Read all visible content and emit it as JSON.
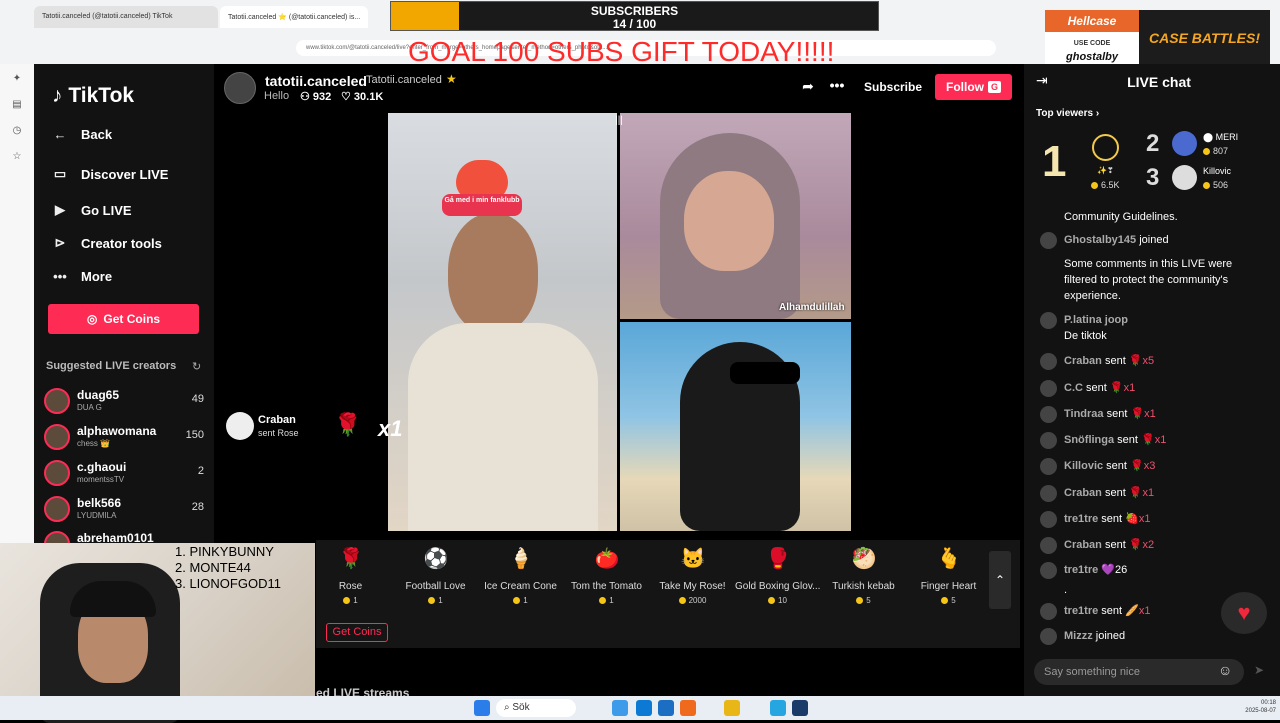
{
  "browser": {
    "tabs": [
      "Tatotii.canceled (@tatotii.canceled) TikTok",
      "Tatotii.canceled ⭐ (@tatotii.canceled) is..."
    ],
    "url": "www.tiktok.com/@tatotii.canceled/live?enter_from_merge=others_homepage&enter_method=others_photo&oth..."
  },
  "overlay": {
    "subscribers_label": "SUBSCRIBERS",
    "subscribers_count": "14 / 100",
    "subscribers_progress": 0.14,
    "goal_text": "GOAL 100 SUBS GIFT TODAY!!!!!",
    "hellcase": {
      "brand": "Hellcase",
      "use_code": "USE CODE",
      "code": "ghostalby",
      "cta": "CASE BATTLES!"
    },
    "leaderboard": [
      "1.  PINKYBUNNY",
      "2.  MONTE44",
      "3.  LIONOFGOD11"
    ]
  },
  "sidebar": {
    "logo": "TikTok",
    "nav": [
      {
        "label": "Back",
        "icon": "arrow-left-icon"
      },
      {
        "label": "Discover LIVE",
        "icon": "tv-icon"
      },
      {
        "label": "Go LIVE",
        "icon": "camera-icon"
      },
      {
        "label": "Creator tools",
        "icon": "play-square-icon"
      },
      {
        "label": "More",
        "icon": "dots-icon"
      }
    ],
    "get_coins": "Get Coins",
    "suggested_title": "Suggested LIVE creators",
    "creators": [
      {
        "name": "duag65",
        "sub": "DUA G",
        "count": "49"
      },
      {
        "name": "alphawomana",
        "sub": "chess 👑",
        "count": "150"
      },
      {
        "name": "c.ghaoui",
        "sub": "momentssTV",
        "count": "2"
      },
      {
        "name": "belk566",
        "sub": "LYUDMILA",
        "count": "28"
      },
      {
        "name": "abreham0101",
        "sub": "",
        "count": ""
      }
    ]
  },
  "stream": {
    "host_name": "tatotii.canceled",
    "host_handle": "Tatotii.canceled",
    "hello": "Hello",
    "viewers": "932",
    "likes": "30.1K",
    "subscribe": "Subscribe",
    "follow": "Follow",
    "follow_badge": "G",
    "badge_text": "Gå med i min fanklubb",
    "caption": "Alhamdulillah",
    "gift_notice": {
      "name": "Craban",
      "text": "sent Rose",
      "mult": "x1"
    }
  },
  "gifts": [
    {
      "name": "Rose",
      "price": "1",
      "icon": "🌹"
    },
    {
      "name": "Football Love",
      "price": "1",
      "icon": "⚽"
    },
    {
      "name": "Ice Cream Cone",
      "price": "1",
      "icon": "🍦"
    },
    {
      "name": "Tom the Tomato",
      "price": "1",
      "icon": "🍅"
    },
    {
      "name": "Take My Rose!",
      "price": "2000",
      "icon": "🐱"
    },
    {
      "name": "Gold Boxing Glov...",
      "price": "10",
      "icon": "🥊"
    },
    {
      "name": "Turkish kebab",
      "price": "5",
      "icon": "🥙"
    },
    {
      "name": "Finger Heart",
      "price": "5",
      "icon": "🫰"
    }
  ],
  "gift_bar": {
    "get_coins": "Get Coins",
    "below": "ed LIVE streams"
  },
  "chat": {
    "title": "LIVE chat",
    "top_viewers": "Top viewers",
    "rank1": {
      "rank": "1",
      "name": "✨❣",
      "score": "6.5K"
    },
    "rank2": {
      "rank": "2",
      "name": "MERI",
      "score": "807"
    },
    "rank3": {
      "rank": "3",
      "name": "Killovic",
      "score": "506"
    },
    "messages": [
      {
        "user": "",
        "text": "Community Guidelines.",
        "gift": ""
      },
      {
        "user": "Ghostalby145",
        "text": " joined",
        "gift": ""
      },
      {
        "user": "",
        "text": "Some comments in this LIVE were filtered to protect the community's experience.",
        "gift": ""
      },
      {
        "user": "P.latina joop",
        "text": "De tiktok",
        "gift": ""
      },
      {
        "user": "Craban",
        "text": " sent",
        "gift": "🌹x5"
      },
      {
        "user": "C.C",
        "text": " sent",
        "gift": "🌹x1"
      },
      {
        "user": "Tindraa",
        "text": " sent",
        "gift": "🌹x1"
      },
      {
        "user": "Snöflinga",
        "text": " sent",
        "gift": "🌹x1"
      },
      {
        "user": "Killovic",
        "text": " sent",
        "gift": "🌹x3"
      },
      {
        "user": "Craban",
        "text": " sent",
        "gift": "🌹x1"
      },
      {
        "user": "tre1tre",
        "text": " sent",
        "gift": "🍓x1"
      },
      {
        "user": "Craban",
        "text": " sent",
        "gift": "🌹x2"
      },
      {
        "user": "tre1tre",
        "text": " 💜26",
        "gift": ""
      },
      {
        "user": "",
        "text": ".",
        "gift": ""
      },
      {
        "user": "tre1tre",
        "text": " sent",
        "gift": "🥖x1"
      },
      {
        "user": "Mizzz",
        "text": " joined",
        "gift": ""
      }
    ],
    "input_placeholder": "Say something nice"
  },
  "taskbar": {
    "search": "Sök",
    "date": "00:18\n2025-08-07"
  }
}
